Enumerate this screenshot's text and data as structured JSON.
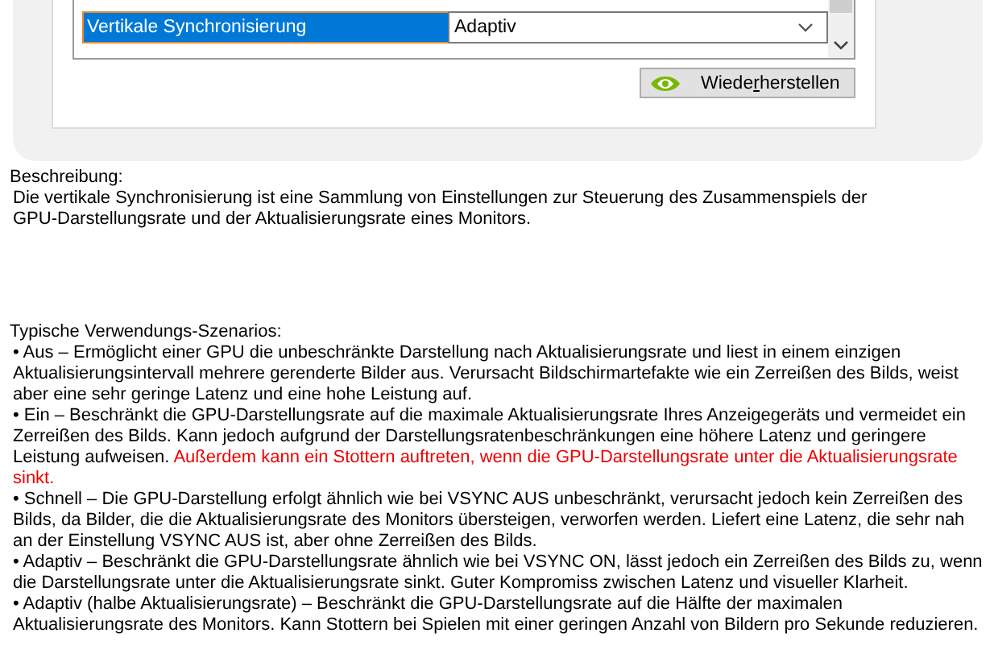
{
  "settings_list": {
    "rows": [
      {
        "label": "Vertikale Synchronisierung",
        "value": "Adaptiv",
        "selected": true
      }
    ]
  },
  "restore_button": {
    "label_before": "Wiede",
    "access_key": "r",
    "label_after": "herstellen"
  },
  "description": {
    "heading": "Beschreibung:",
    "text": "Die vertikale Synchronisierung ist eine Sammlung von Einstellungen zur Steuerung des Zusammenspiels der GPU-Darstellungsrate und der Aktualisierungsrate eines Monitors."
  },
  "scenarios": {
    "heading": "Typische Verwendungs-Szenarios:",
    "items": [
      {
        "text": "• Aus – Ermöglicht einer GPU die unbeschränkte Darstellung nach Aktualisierungsrate und liest in einem einzigen Aktualisierungsintervall mehrere gerenderte Bilder aus. Verursacht Bildschirmartefakte wie ein Zerreißen des Bilds, weist aber eine sehr geringe Latenz und eine hohe Leistung auf."
      },
      {
        "text": "• Ein – Beschränkt die GPU-Darstellungsrate auf die maximale Aktualisierungsrate Ihres Anzeigegeräts und vermeidet ein Zerreißen des Bilds. Kann jedoch aufgrund der Darstellungsratenbeschränkungen eine höhere Latenz und geringere Leistung aufweisen.",
        "warning": "Außerdem kann ein Stottern auftreten, wenn die GPU-Darstellungsrate unter die Aktualisierungsrate sinkt."
      },
      {
        "text": "• Schnell – Die GPU-Darstellung erfolgt ähnlich wie bei VSYNC AUS unbeschränkt, verursacht jedoch kein Zerreißen des Bilds, da Bilder, die die Aktualisierungsrate des Monitors übersteigen, verworfen werden. Liefert eine Latenz, die sehr nah an der Einstellung VSYNC AUS ist, aber ohne Zerreißen des Bilds."
      },
      {
        "text": "• Adaptiv – Beschränkt die GPU-Darstellungsrate ähnlich wie bei VSYNC ON, lässt jedoch ein Zerreißen des Bilds zu, wenn die Darstellungsrate unter die Aktualisierungsrate sinkt. Guter Kompromiss zwischen Latenz und visueller Klarheit."
      },
      {
        "text": "• Adaptiv (halbe Aktualisierungsrate) – Beschränkt die GPU-Darstellungsrate auf die Hälfte der maximalen Aktualisierungsrate des Monitors. Kann Stottern bei Spielen mit einer geringen Anzahl von Bildern pro Sekunde reduzieren."
      }
    ]
  }
}
